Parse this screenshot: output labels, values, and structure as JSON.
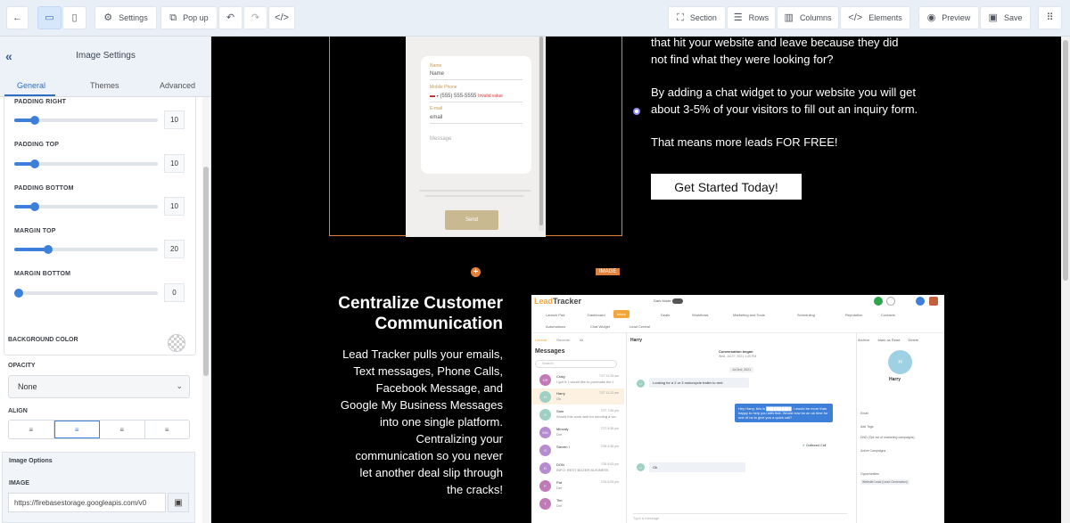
{
  "toolbar": {
    "settings_label": "Settings",
    "popup_label": "Pop up",
    "section_label": "Section",
    "rows_label": "Rows",
    "columns_label": "Columns",
    "elements_label": "Elements",
    "preview_label": "Preview",
    "save_label": "Save"
  },
  "panel": {
    "title": "Image Settings",
    "tabs": [
      {
        "label": "General"
      },
      {
        "label": "Themes"
      },
      {
        "label": "Advanced"
      }
    ],
    "sliders": [
      {
        "label": "PADDING RIGHT",
        "value": "10",
        "fraction": 0.12
      },
      {
        "label": "PADDING TOP",
        "value": "10",
        "fraction": 0.12
      },
      {
        "label": "PADDING BOTTOM",
        "value": "10",
        "fraction": 0.12
      },
      {
        "label": "MARGIN TOP",
        "value": "20",
        "fraction": 0.22
      },
      {
        "label": "MARGIN BOTTOM",
        "value": "0",
        "fraction": 0.0
      }
    ],
    "background_color_label": "BACKGROUND COLOR",
    "opacity_label": "OPACITY",
    "opacity_value": "None",
    "align_label": "ALIGN",
    "image_options_label": "Image Options",
    "image_label": "IMAGE",
    "image_url": "https://firebasestorage.googleapis.com/v0"
  },
  "canvas": {
    "image_tag": "IMAGE",
    "form": {
      "name_label": "Name",
      "name_value": "Name",
      "phone_label": "Mobile Phone",
      "phone_value": "(555) 555-5555",
      "phone_error": "Invalid value",
      "email_label": "E-mail",
      "email_value": "email",
      "message_placeholder": "Message",
      "send_label": "Send"
    },
    "right_text": {
      "line1": "that hit your website and leave because they did",
      "line2": "not find what they were looking for?",
      "para2_line1": "By adding a chat widget to your website you will get",
      "para2_line2": "about 3-5% of your visitors to fill out an inquiry form.",
      "para3": "That means more leads FOR FREE!"
    },
    "cta_label": "Get Started Today!",
    "heading_line1": "Centralize Customer",
    "heading_line2": "Communication",
    "body_lines": [
      "Lead Tracker pulls your emails,",
      "Text messages, Phone Calls,",
      "Facebook Message, and",
      "Google My Business Messages",
      "into one single platform.",
      "Centralizing your",
      "communication so you never",
      "let another deal slip through",
      "the cracks!"
    ]
  },
  "app": {
    "logo_lead": "Lead",
    "logo_tracker": "Tracker",
    "dark_mode": "Dark Mode",
    "nav": [
      "Launch Pad",
      "Dashboard",
      "Inbox",
      "Deals",
      "Workflows",
      "Marketing and Tools",
      "Scheduling",
      "Reputation",
      "Contacts",
      "Automations",
      "Chat Widget",
      "Lead Central"
    ],
    "sidebar_tabs": [
      "Unread",
      "Recents",
      "All"
    ],
    "messages_title": "Messages",
    "search_placeholder": "Search",
    "conversations": [
      {
        "initials": "CR",
        "name": "Craig",
        "snippet": "I got it. I would like to purchase the t",
        "time": "7/27 11:25 am",
        "color": "#c07ab8"
      },
      {
        "initials": "H",
        "name": "Harry",
        "snippet": "Ok",
        "time": "7/27 11:23 am",
        "color": "#9fcfc5"
      },
      {
        "initials": "S",
        "name": "Sam",
        "snippet": "Would this work well for sending a wo",
        "time": "7/27 7:56 pm",
        "color": "#9fcfc5"
      },
      {
        "initials": "MN",
        "name": "Mincaly",
        "snippet": "Def",
        "time": "7/27 8:35 pm",
        "color": "#b48ccf"
      },
      {
        "initials": "S",
        "name": "Steven I",
        "snippet": "",
        "time": "7/26 9:38 pm",
        "color": "#b48ccf"
      },
      {
        "initials": "D",
        "name": "DON",
        "snippet": "INFO: REST BOZER BUSINESS",
        "time": "7/26 8:53 pm",
        "color": "#b48ccf"
      },
      {
        "initials": "P",
        "name": "Pat",
        "snippet": "Def",
        "time": "7/24 6:05 pm",
        "color": "#c07ab8"
      },
      {
        "initials": "T",
        "name": "Tim",
        "snippet": "Def",
        "time": "",
        "color": "#c07ab8"
      }
    ],
    "chat_header": "Harry",
    "conversation_started": "Conversation began",
    "conversation_date": "Wed, Jul 27, 2021 1:45 PM",
    "date_chip": "Jul 2nd, 2021",
    "msg_in_1": "Looking for a 2 or 3 motorcycle trailer to rent",
    "msg_out_1": "Hey Harry, this is ██████████. I would be more than happy to help you with that. Would now be an ok time for one of us to give you a quick call?",
    "outbound_call": "Outbound Call",
    "msg_in_2": "Ok",
    "type_placeholder": "Type a message",
    "contact_name": "Harry",
    "contact_initials": "H",
    "email_label": "Email",
    "add_tags": "Add Tags",
    "dnd_label": "DND (Opt out of marketing campaigns)",
    "active_campaigns": "Active Campaigns",
    "opportunities": "Opportunities",
    "opportunity_tag": "Website Lead (Lead Generation)",
    "actions": [
      "Archive",
      "Mark as Read",
      "Delete"
    ]
  }
}
